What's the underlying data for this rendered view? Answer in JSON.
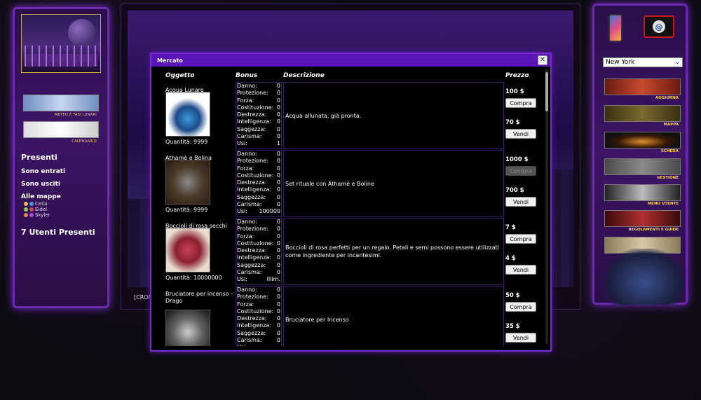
{
  "left": {
    "banners": [
      "METEO E FASI LUNARI",
      "CALENDARIO"
    ],
    "presence_title": "Presenti",
    "links": [
      "Sono entrati",
      "Sono usciti",
      "Alle mappe"
    ],
    "users": [
      "Celia",
      "Eidel",
      "Skyler"
    ],
    "users_count": "7 Utenti Presenti"
  },
  "center": {
    "cron_text": "[CRON"
  },
  "right": {
    "city_select": "New York",
    "nav": [
      "AGGIORNA",
      "MAPPA",
      "SCHEDA",
      "GESTIONE",
      "MENU UTENTE",
      "REGOLAMENTI E GUIDE"
    ]
  },
  "modal": {
    "title": "Mercato",
    "columns": {
      "item": "Oggetto",
      "bonus": "Bonus",
      "desc": "Descrizione",
      "price": "Prezzo"
    },
    "bonus_labels": [
      "Danno:",
      "Protezione:",
      "Forza:",
      "Costituzione:",
      "Destrezza:",
      "Intelligenza:",
      "Saggezza:",
      "Carisma:",
      "Usi:"
    ],
    "buy_label": "Compra",
    "sell_label": "Vendi",
    "items": [
      {
        "name": "Acqua Lunare",
        "qty": "Quantità: 9999",
        "bonus": [
          "0",
          "0",
          "0",
          "0",
          "0",
          "0",
          "0",
          "0",
          "1"
        ],
        "desc": "Acqua allunata, già pronta.",
        "buy_price": "100 $",
        "sell_price": "70 $",
        "buy_disabled": false
      },
      {
        "name": "Athamè e Bolina",
        "qty": "Quantità: 9999",
        "bonus": [
          "0",
          "0",
          "0",
          "0",
          "0",
          "0",
          "0",
          "0",
          "100000"
        ],
        "desc": "Set rituale con Athamè e Boline",
        "buy_price": "1000 $",
        "sell_price": "700 $",
        "buy_disabled": true
      },
      {
        "name": "Boccioli di rosa secchi",
        "qty": "Quantità: 10000000",
        "bonus": [
          "0",
          "0",
          "0",
          "0",
          "0",
          "0",
          "0",
          "0",
          "Illim."
        ],
        "desc": "Boccioli di rosa perfetti per un regalo. Petali e semi possono essere utilizzati come ingrediente per incantesimi.",
        "buy_price": "7 $",
        "sell_price": "4 $",
        "buy_disabled": false
      },
      {
        "name": "Bruciatore per incenso - Drago",
        "qty": "",
        "bonus": [
          "0",
          "0",
          "0",
          "0",
          "0",
          "0",
          "0",
          "0",
          ""
        ],
        "desc": "Bruciatore per Incenso",
        "buy_price": "50 $",
        "sell_price": "35 $",
        "buy_disabled": false
      }
    ]
  }
}
